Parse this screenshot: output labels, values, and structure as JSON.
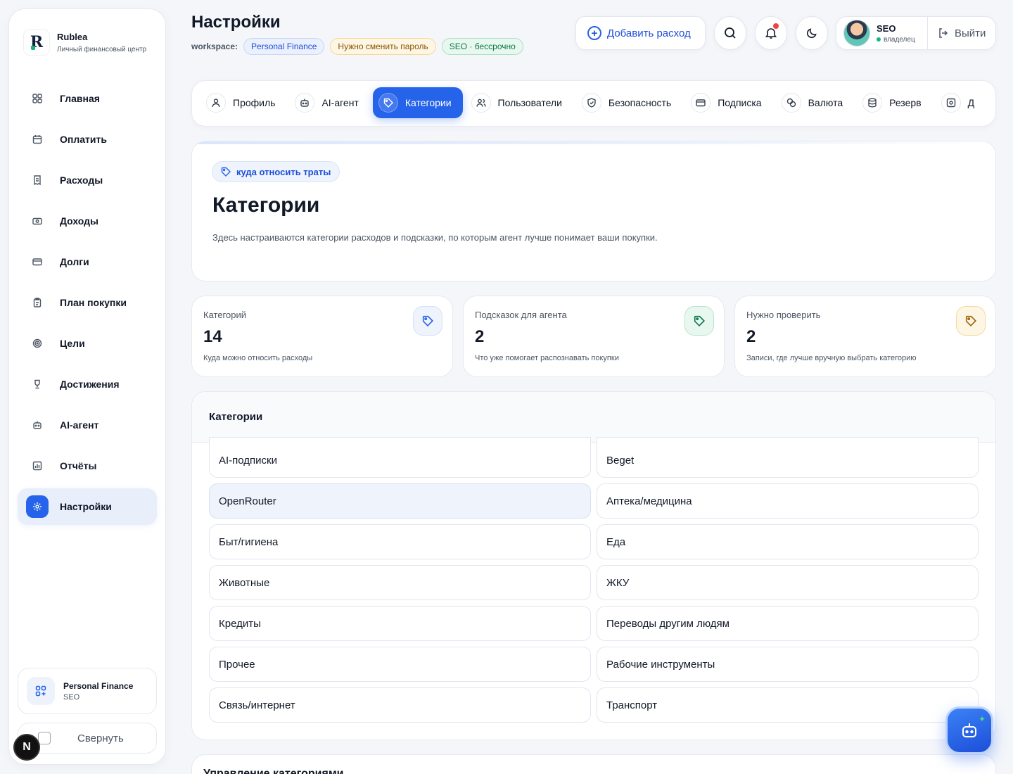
{
  "brand": {
    "name": "Rublea",
    "subtitle": "Личный финансовый центр"
  },
  "nav": [
    {
      "label": "Главная",
      "icon": "grid-icon"
    },
    {
      "label": "Оплатить",
      "icon": "calendar-icon"
    },
    {
      "label": "Расходы",
      "icon": "receipt-icon"
    },
    {
      "label": "Доходы",
      "icon": "cash-icon"
    },
    {
      "label": "Долги",
      "icon": "card-icon"
    },
    {
      "label": "План покупки",
      "icon": "clipboard-icon"
    },
    {
      "label": "Цели",
      "icon": "target-icon"
    },
    {
      "label": "Достижения",
      "icon": "trophy-icon"
    },
    {
      "label": "AI-агент",
      "icon": "bot-icon"
    },
    {
      "label": "Отчёты",
      "icon": "chart-icon"
    },
    {
      "label": "Настройки",
      "icon": "settings-icon",
      "active": true
    }
  ],
  "workspace_card": {
    "name": "Personal Finance",
    "sub": "SEO"
  },
  "collapse_label": "Свернуть",
  "next_badge": "N",
  "header": {
    "title": "Настройки",
    "workspace_label": "workspace:",
    "pills": [
      "Personal Finance",
      "Нужно сменить пароль",
      "SEO · бессрочно"
    ],
    "add_expense": "Добавить расход",
    "user_name": "SEO",
    "user_role": "владелец",
    "logout": "Выйти"
  },
  "tabs": [
    {
      "label": "Профиль",
      "icon": "user-icon"
    },
    {
      "label": "AI-агент",
      "icon": "bot-icon"
    },
    {
      "label": "Категории",
      "icon": "tag-icon",
      "active": true
    },
    {
      "label": "Пользователи",
      "icon": "users-icon"
    },
    {
      "label": "Безопасность",
      "icon": "shield-icon"
    },
    {
      "label": "Подписка",
      "icon": "card-icon"
    },
    {
      "label": "Валюта",
      "icon": "coins-icon"
    },
    {
      "label": "Резерв",
      "icon": "database-icon"
    },
    {
      "label": "Д",
      "icon": "device-icon"
    }
  ],
  "hero": {
    "pill": "куда относить траты",
    "title": "Категории",
    "description": "Здесь настраиваются категории расходов и подсказки, по которым агент лучше понимает ваши покупки."
  },
  "stats": [
    {
      "label": "Категорий",
      "value": "14",
      "sub": "Куда можно относить расходы",
      "color": "#2563eb"
    },
    {
      "label": "Подсказок для агента",
      "value": "2",
      "sub": "Что уже помогает распознавать покупки",
      "color": "#0a7a44"
    },
    {
      "label": "Нужно проверить",
      "value": "2",
      "sub": "Записи, где лучше вручную выбрать категорию",
      "color": "#a16207"
    }
  ],
  "categories": {
    "title": "Категории",
    "items": [
      "AI-подписки",
      "Beget",
      "OpenRouter",
      "Аптека/медицина",
      "Быт/гигиена",
      "Еда",
      "Животные",
      "ЖКУ",
      "Кредиты",
      "Переводы другим людям",
      "Прочее",
      "Рабочие инструменты",
      "Связь/интернет",
      "Транспорт"
    ]
  },
  "manage_title": "Управление категориями",
  "colors": {
    "accent": "#2563eb",
    "background": "#f4f6fa"
  }
}
